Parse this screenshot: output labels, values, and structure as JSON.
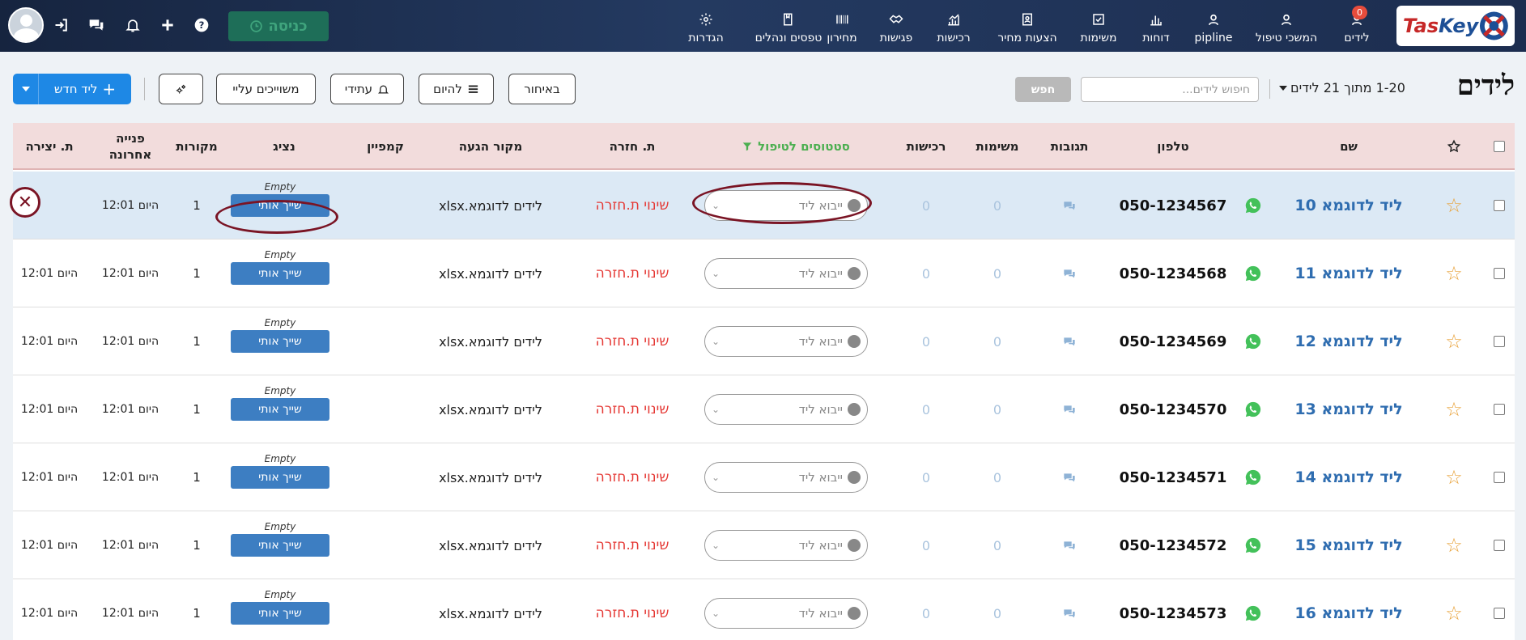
{
  "topbar": {
    "entry_button": "כניסה",
    "nav": [
      {
        "label": "לידים",
        "icon": "user-icon",
        "badge": "0"
      },
      {
        "label": "המשכי טיפול",
        "icon": "user-icon"
      },
      {
        "label": "pipline",
        "icon": "user-icon"
      },
      {
        "label": "דוחות",
        "icon": "bar-chart-icon"
      },
      {
        "label": "משימות",
        "icon": "checkbox-icon"
      },
      {
        "label": "הצעות מחיר",
        "icon": "document-user-icon"
      },
      {
        "label": "רכישות",
        "icon": "growth-chart-icon"
      },
      {
        "label": "פגישות",
        "icon": "handshake-icon"
      },
      {
        "label": "מחירון",
        "icon": "barcode-icon"
      },
      {
        "label": "טפסים ונהלים",
        "icon": "book-icon"
      },
      {
        "label": "הגדרות",
        "icon": "gear-icon"
      }
    ],
    "logo": {
      "text_red": "Tas",
      "text_blue": "Key"
    }
  },
  "page": {
    "title": "לידים",
    "pager_text": "1-20 מתוך 21 לידים",
    "search_placeholder": "חיפוש לידים...",
    "search_button": "חפש"
  },
  "toolbar": {
    "new_lead": "ליד חדש",
    "assigned_to_me": "משוייכים עליי",
    "future": "עתידי",
    "today": "להיום",
    "late": "באיחור"
  },
  "columns": {
    "name": "שם",
    "phone": "טלפון",
    "responses": "תגובות",
    "tasks": "משימות",
    "purchases": "רכישות",
    "statuses": "סטטוסים לטיפול",
    "return_date": "ת. חזרה",
    "arrival_source": "מקור הגעה",
    "campaign": "קמפיין",
    "agent": "נציג",
    "sources": "מקורות",
    "last_contact": "פנייה אחרונה",
    "created": "ת. יצירה"
  },
  "rows": [
    {
      "name": "ליד לדוגמא 10",
      "phone": "050-1234567",
      "tasks": "0",
      "purchases": "0",
      "status": "ייבוא ליד",
      "return_date": "שינוי ת.חזרה",
      "source": "לידים לדוגמא.xlsx",
      "agent_empty": "Empty",
      "assign": "שייך אותי",
      "sources": "1",
      "last_contact": "היום 12:01",
      "created": ""
    },
    {
      "name": "ליד לדוגמא 11",
      "phone": "050-1234568",
      "tasks": "0",
      "purchases": "0",
      "status": "ייבוא ליד",
      "return_date": "שינוי ת.חזרה",
      "source": "לידים לדוגמא.xlsx",
      "agent_empty": "Empty",
      "assign": "שייך אותי",
      "sources": "1",
      "last_contact": "היום 12:01",
      "created": "היום 12:01"
    },
    {
      "name": "ליד לדוגמא 12",
      "phone": "050-1234569",
      "tasks": "0",
      "purchases": "0",
      "status": "ייבוא ליד",
      "return_date": "שינוי ת.חזרה",
      "source": "לידים לדוגמא.xlsx",
      "agent_empty": "Empty",
      "assign": "שייך אותי",
      "sources": "1",
      "last_contact": "היום 12:01",
      "created": "היום 12:01"
    },
    {
      "name": "ליד לדוגמא 13",
      "phone": "050-1234570",
      "tasks": "0",
      "purchases": "0",
      "status": "ייבוא ליד",
      "return_date": "שינוי ת.חזרה",
      "source": "לידים לדוגמא.xlsx",
      "agent_empty": "Empty",
      "assign": "שייך אותי",
      "sources": "1",
      "last_contact": "היום 12:01",
      "created": "היום 12:01"
    },
    {
      "name": "ליד לדוגמא 14",
      "phone": "050-1234571",
      "tasks": "0",
      "purchases": "0",
      "status": "ייבוא ליד",
      "return_date": "שינוי ת.חזרה",
      "source": "לידים לדוגמא.xlsx",
      "agent_empty": "Empty",
      "assign": "שייך אותי",
      "sources": "1",
      "last_contact": "היום 12:01",
      "created": "היום 12:01"
    },
    {
      "name": "ליד לדוגמא 15",
      "phone": "050-1234572",
      "tasks": "0",
      "purchases": "0",
      "status": "ייבוא ליד",
      "return_date": "שינוי ת.חזרה",
      "source": "לידים לדוגמא.xlsx",
      "agent_empty": "Empty",
      "assign": "שייך אותי",
      "sources": "1",
      "last_contact": "היום 12:01",
      "created": "היום 12:01"
    },
    {
      "name": "ליד לדוגמא 16",
      "phone": "050-1234573",
      "tasks": "0",
      "purchases": "0",
      "status": "ייבוא ליד",
      "return_date": "שינוי ת.חזרה",
      "source": "לידים לדוגמא.xlsx",
      "agent_empty": "Empty",
      "assign": "שייך אותי",
      "sources": "1",
      "last_contact": "היום 12:01",
      "created": "היום 12:01"
    }
  ],
  "colors": {
    "accent": "#1e88e5",
    "header_bg": "#f2dcdc",
    "highlight_row": "#dce9f5",
    "annotation": "#7a1424",
    "lead_link": "#2f6db0",
    "return_red": "#e53935"
  }
}
